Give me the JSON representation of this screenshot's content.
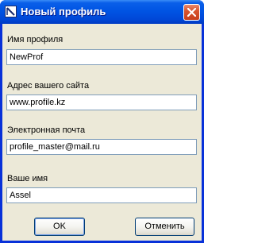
{
  "window": {
    "title": "Новый профиль",
    "icons": {
      "app": "app-icon",
      "close": "close-icon"
    }
  },
  "form": {
    "fields": [
      {
        "label": "Имя профиля",
        "value": "NewProf"
      },
      {
        "label": "Адрес вашего сайта",
        "value": "www.profile.kz"
      },
      {
        "label": "Электронная почта",
        "value": "profile_master@mail.ru"
      },
      {
        "label": "Ваше имя",
        "value": "Assel"
      }
    ]
  },
  "buttons": {
    "ok_label": "OK",
    "cancel_label": "Отменить"
  },
  "colors": {
    "titlebar": "#0054e3",
    "frame": "#0831d9",
    "client_bg": "#ece9d8",
    "close_button": "#d8542e",
    "input_border": "#7f9db9"
  }
}
